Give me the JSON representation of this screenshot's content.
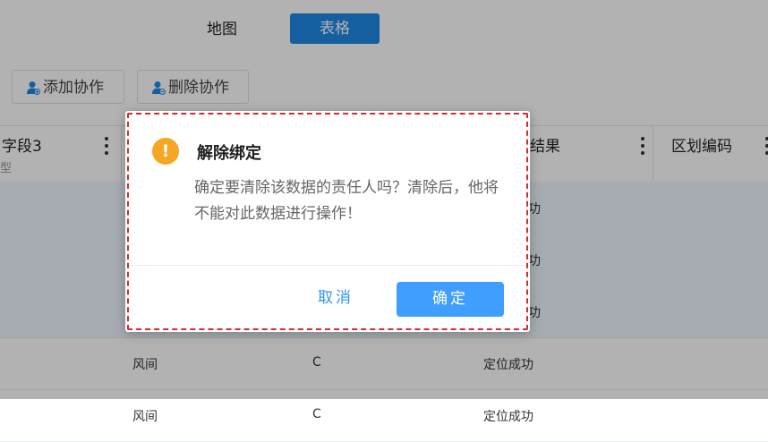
{
  "tabs": {
    "map": "地图",
    "table": "表格"
  },
  "toolbar": {
    "add_collab": "添加协作",
    "remove_collab": "删除协作"
  },
  "table": {
    "headers": {
      "field3": "字段3",
      "field3_sub": "型",
      "result": "结果",
      "region_code": "区划编码"
    },
    "rows": [
      {
        "name": "",
        "value": "",
        "result": "功"
      },
      {
        "name": "",
        "value": "",
        "result": "功"
      },
      {
        "name": "",
        "value": "",
        "result": "功"
      },
      {
        "name": "风间",
        "value": "C",
        "result": "定位成功"
      },
      {
        "name": "风间",
        "value": "C",
        "result": "定位成功"
      }
    ]
  },
  "dialog": {
    "title": "解除绑定",
    "message": "确定要清除该数据的责任人吗？清除后，他将不能对此数据进行操作！",
    "cancel": "取消",
    "confirm": "确定",
    "icon": "warning-icon"
  },
  "colors": {
    "primary": "#409eff",
    "tab_active": "#1e88e5",
    "warning": "#f5a623",
    "highlight_outline": "#d9282f",
    "row_highlight": "#ecf5fd"
  }
}
